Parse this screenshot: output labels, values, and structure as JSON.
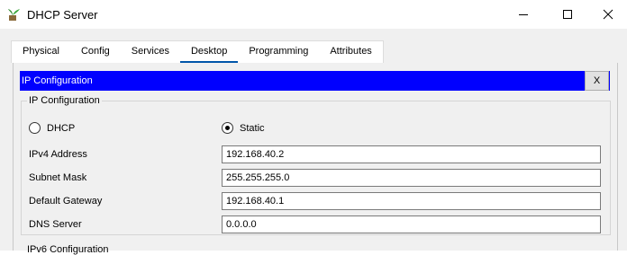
{
  "window": {
    "title": "DHCP Server",
    "icon": "server-plant-icon"
  },
  "tabs": [
    {
      "label": "Physical",
      "active": false
    },
    {
      "label": "Config",
      "active": false
    },
    {
      "label": "Services",
      "active": false
    },
    {
      "label": "Desktop",
      "active": true
    },
    {
      "label": "Programming",
      "active": false
    },
    {
      "label": "Attributes",
      "active": false
    }
  ],
  "ip_config": {
    "banner_title": "IP Configuration",
    "close_label": "X",
    "group_title": "IP Configuration",
    "mode": {
      "dhcp_label": "DHCP",
      "static_label": "Static",
      "selected": "Static"
    },
    "fields": [
      {
        "label": "IPv4 Address",
        "value": "192.168.40.2"
      },
      {
        "label": "Subnet Mask",
        "value": "255.255.255.0"
      },
      {
        "label": "Default Gateway",
        "value": "192.168.40.1"
      },
      {
        "label": "DNS Server",
        "value": "0.0.0.0"
      }
    ],
    "next_group_title": "IPv6 Configuration"
  },
  "colors": {
    "banner": "#0000ff",
    "active_tab_underline": "#0055aa"
  }
}
